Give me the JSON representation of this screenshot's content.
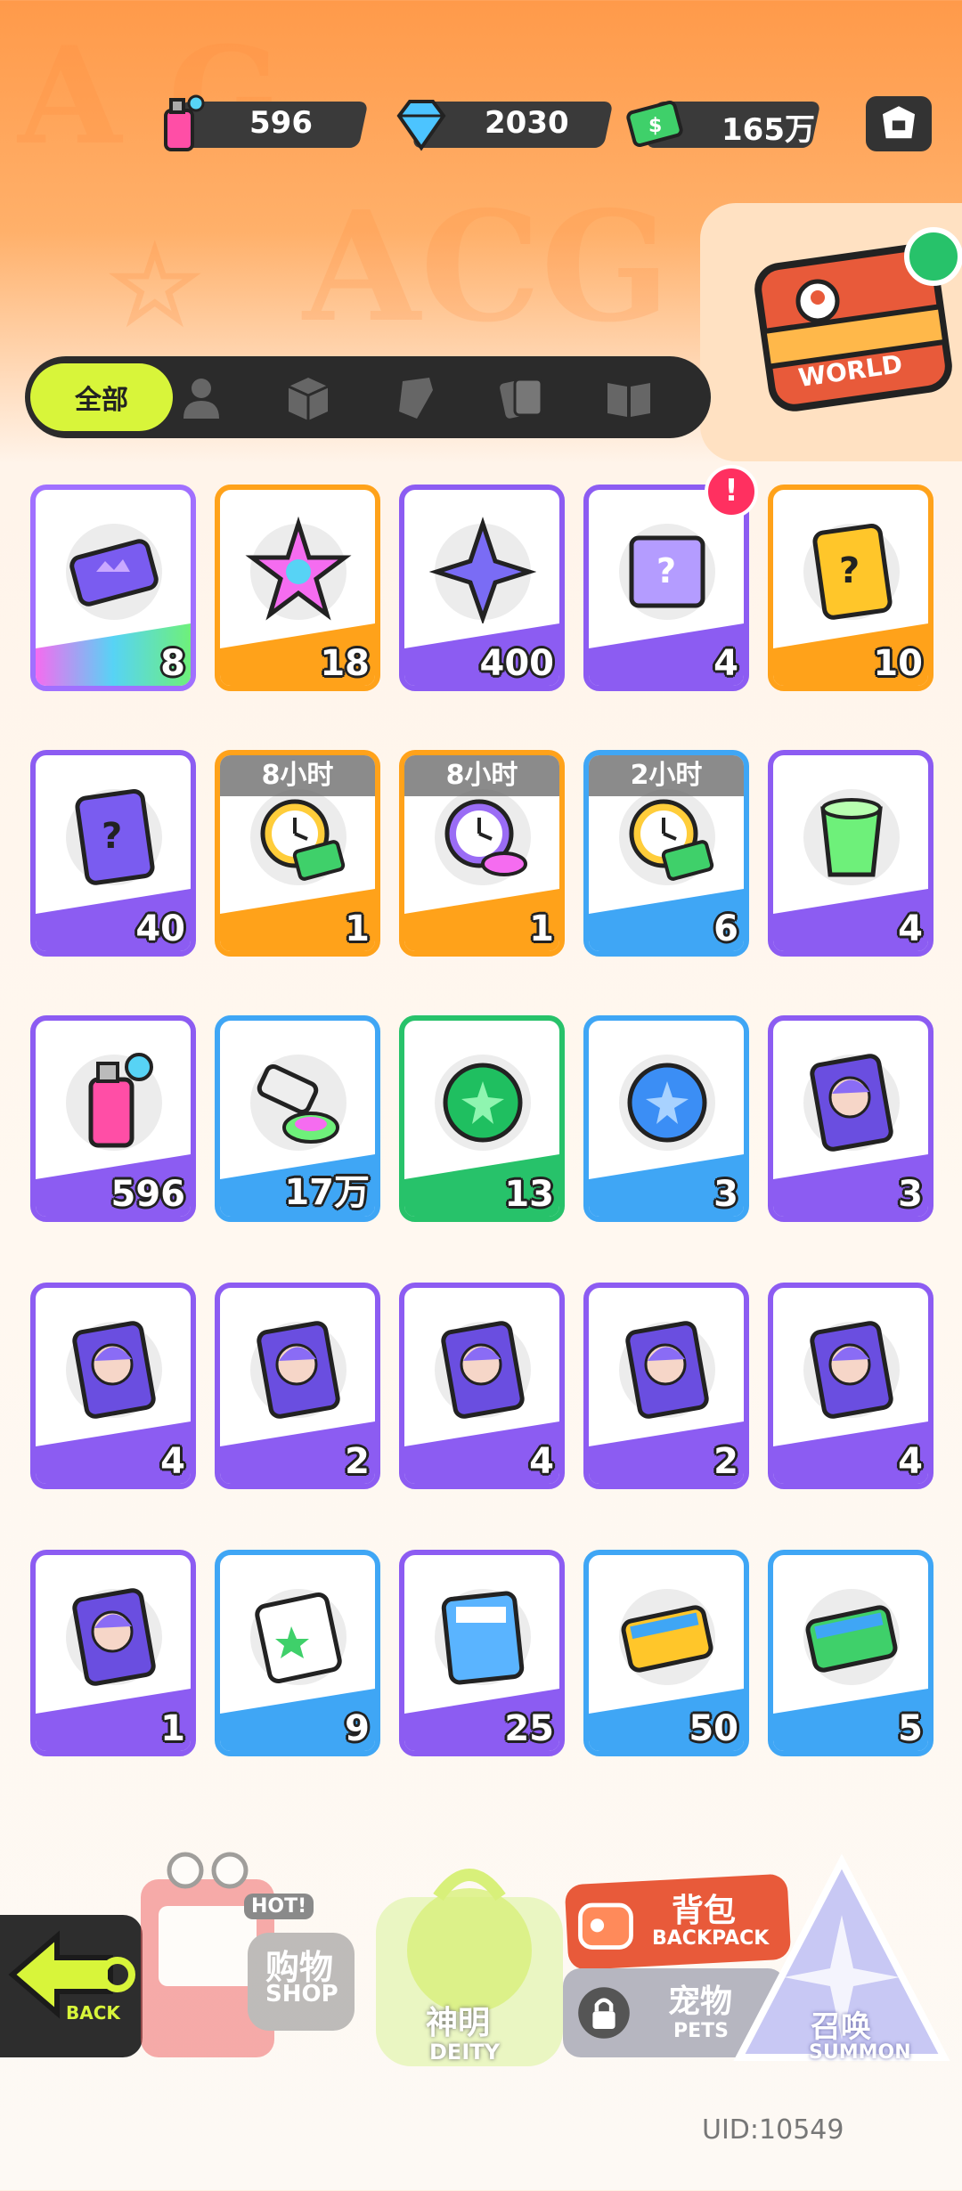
{
  "currencies": [
    {
      "name": "spray-can",
      "value": "596"
    },
    {
      "name": "diamond",
      "value": "2030"
    },
    {
      "name": "cash",
      "value": "165万"
    }
  ],
  "world_badge": {
    "label": "WORLD"
  },
  "tabs": {
    "all_label": "全部",
    "icons": [
      "person-icon",
      "box-icon",
      "tag-icon",
      "cards-icon",
      "book-icon"
    ]
  },
  "items": [
    {
      "icon": "ticket-crown-icon",
      "count": "8",
      "rarity": "rainbow",
      "timer": ""
    },
    {
      "icon": "rainbow-star-icon",
      "count": "18",
      "rarity": "orange",
      "timer": ""
    },
    {
      "icon": "purple-star-icon",
      "count": "400",
      "rarity": "purple",
      "timer": ""
    },
    {
      "icon": "mystery-box-icon",
      "count": "4",
      "rarity": "purple",
      "timer": "",
      "alert": "!"
    },
    {
      "icon": "gold-mystery-card-icon",
      "count": "10",
      "rarity": "orange",
      "timer": ""
    },
    {
      "icon": "purple-mystery-card-icon",
      "count": "40",
      "rarity": "purple",
      "timer": ""
    },
    {
      "icon": "alarm-cash-icon",
      "count": "1",
      "rarity": "orange",
      "timer": "8小时"
    },
    {
      "icon": "alarm-paint-icon",
      "count": "1",
      "rarity": "orange",
      "timer": "8小时"
    },
    {
      "icon": "alarm-cash-icon",
      "count": "6",
      "rarity": "blue",
      "timer": "2小时"
    },
    {
      "icon": "green-drink-icon",
      "count": "4",
      "rarity": "purple",
      "timer": ""
    },
    {
      "icon": "spray-can-icon",
      "count": "596",
      "rarity": "purple",
      "timer": ""
    },
    {
      "icon": "paint-tube-icon",
      "count": "17万",
      "rarity": "blue",
      "timer": ""
    },
    {
      "icon": "green-orb-icon",
      "count": "13",
      "rarity": "green",
      "timer": ""
    },
    {
      "icon": "blue-orb-icon",
      "count": "3",
      "rarity": "blue",
      "timer": ""
    },
    {
      "icon": "character-card-icon",
      "count": "3",
      "rarity": "purple",
      "timer": ""
    },
    {
      "icon": "character-card-icon",
      "count": "4",
      "rarity": "purple",
      "timer": ""
    },
    {
      "icon": "character-card-icon",
      "count": "2",
      "rarity": "purple",
      "timer": ""
    },
    {
      "icon": "character-card-icon",
      "count": "4",
      "rarity": "purple",
      "timer": ""
    },
    {
      "icon": "character-card-icon",
      "count": "2",
      "rarity": "purple",
      "timer": ""
    },
    {
      "icon": "character-card-icon",
      "count": "4",
      "rarity": "purple",
      "timer": ""
    },
    {
      "icon": "character-card-icon",
      "count": "1",
      "rarity": "purple",
      "timer": ""
    },
    {
      "icon": "sticker-pack-icon",
      "count": "9",
      "rarity": "blue",
      "timer": ""
    },
    {
      "icon": "energy-pack-icon",
      "count": "25",
      "rarity": "purple",
      "timer": ""
    },
    {
      "icon": "yellow-coupon-icon",
      "count": "50",
      "rarity": "blue",
      "timer": ""
    },
    {
      "icon": "green-coupon-icon",
      "count": "5",
      "rarity": "blue",
      "timer": ""
    }
  ],
  "nav": {
    "back": "BACK",
    "shop_cn": "购物",
    "shop_en": "SHOP",
    "shop_hot": "HOT!",
    "deity_cn": "神明",
    "deity_en": "DEITY",
    "backpack_cn": "背包",
    "backpack_en": "BACKPACK",
    "pets_cn": "宠物",
    "pets_en": "PETS",
    "summon_cn": "召唤",
    "summon_en": "SUMMON"
  },
  "uid": "UID:10549",
  "colors": {
    "purple": "#8c5cf2",
    "orange": "#ffa21a",
    "blue": "#3fa6f5",
    "green": "#27c26a",
    "lime": "#d8f53a"
  }
}
